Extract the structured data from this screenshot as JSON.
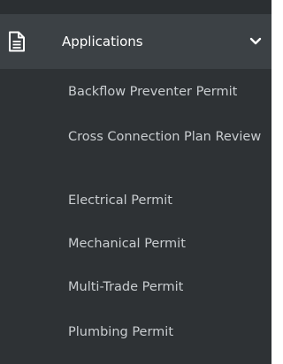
{
  "menu": {
    "section_label": "Applications",
    "section_icon": "document-icon",
    "expand_icon": "chevron-down-icon",
    "items": [
      {
        "label": "Backflow Preventer Permit"
      },
      {
        "label": "Cross Connection Plan Review"
      },
      {
        "label": "Electrical Permit"
      },
      {
        "label": "Mechanical Permit"
      },
      {
        "label": "Multi-Trade Permit"
      },
      {
        "label": "Plumbing Permit"
      }
    ]
  },
  "colors": {
    "sidebar_bg": "#2e3235",
    "header_bg": "#3c4145",
    "header_text": "#ffffff",
    "item_text": "#c9cdd0"
  }
}
